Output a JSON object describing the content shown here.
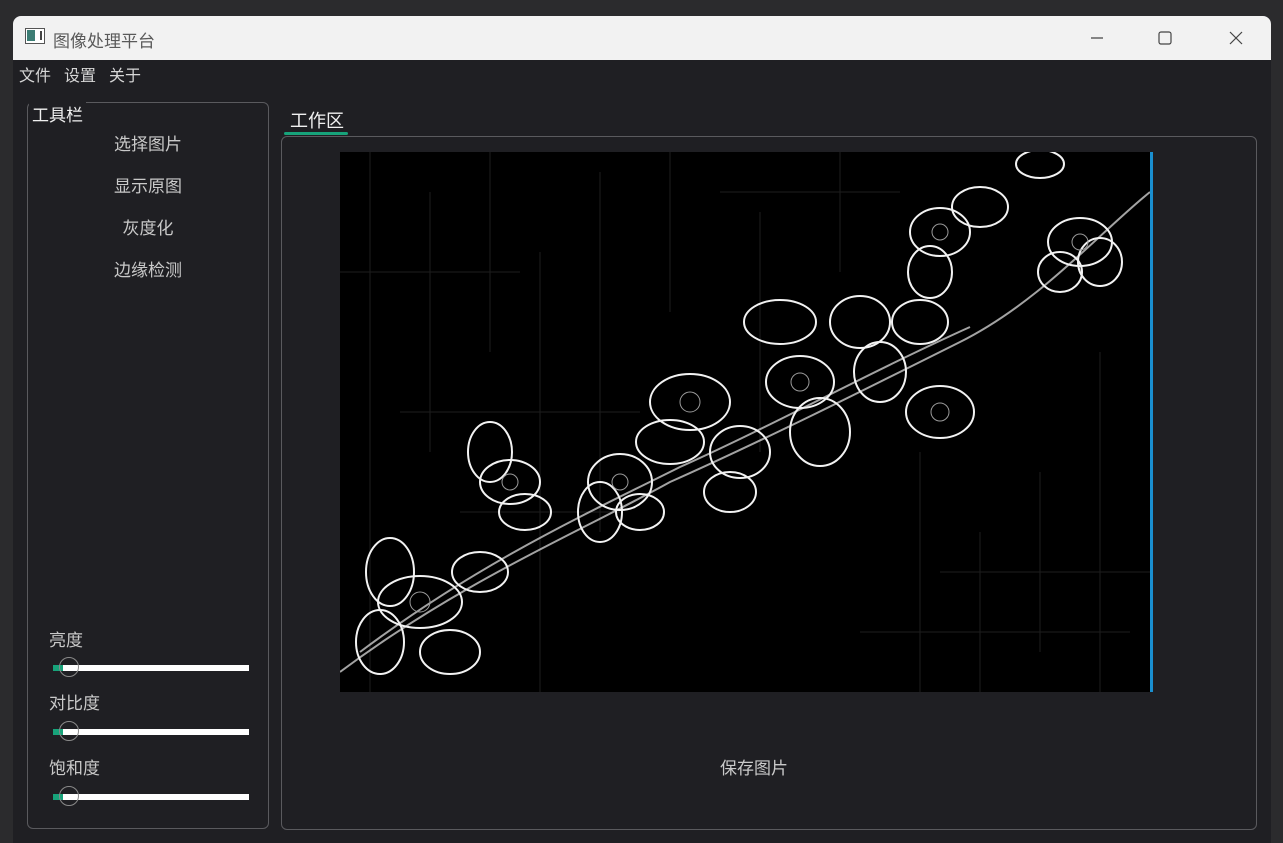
{
  "window": {
    "title": "图像处理平台",
    "controls": {
      "minimize": "minimize-icon",
      "maximize": "maximize-icon",
      "close": "close-icon"
    }
  },
  "menu": {
    "items": [
      "文件",
      "设置",
      "关于"
    ]
  },
  "toolbar": {
    "title": "工具栏",
    "buttons": [
      "选择图片",
      "显示原图",
      "灰度化",
      "边缘检测"
    ],
    "sliders": [
      {
        "label": "亮度",
        "value": 0.05
      },
      {
        "label": "对比度",
        "value": 0.05
      },
      {
        "label": "饱和度",
        "value": 0.05
      }
    ]
  },
  "workspace": {
    "tab": "工作区",
    "save_button": "保存图片",
    "image": "edge-detected flower branch image"
  },
  "colors": {
    "accent": "#17a37a",
    "window_bg": "#1f1f23",
    "titlebar_bg": "#f2f2f2",
    "image_edge": "#1a8fd0"
  }
}
